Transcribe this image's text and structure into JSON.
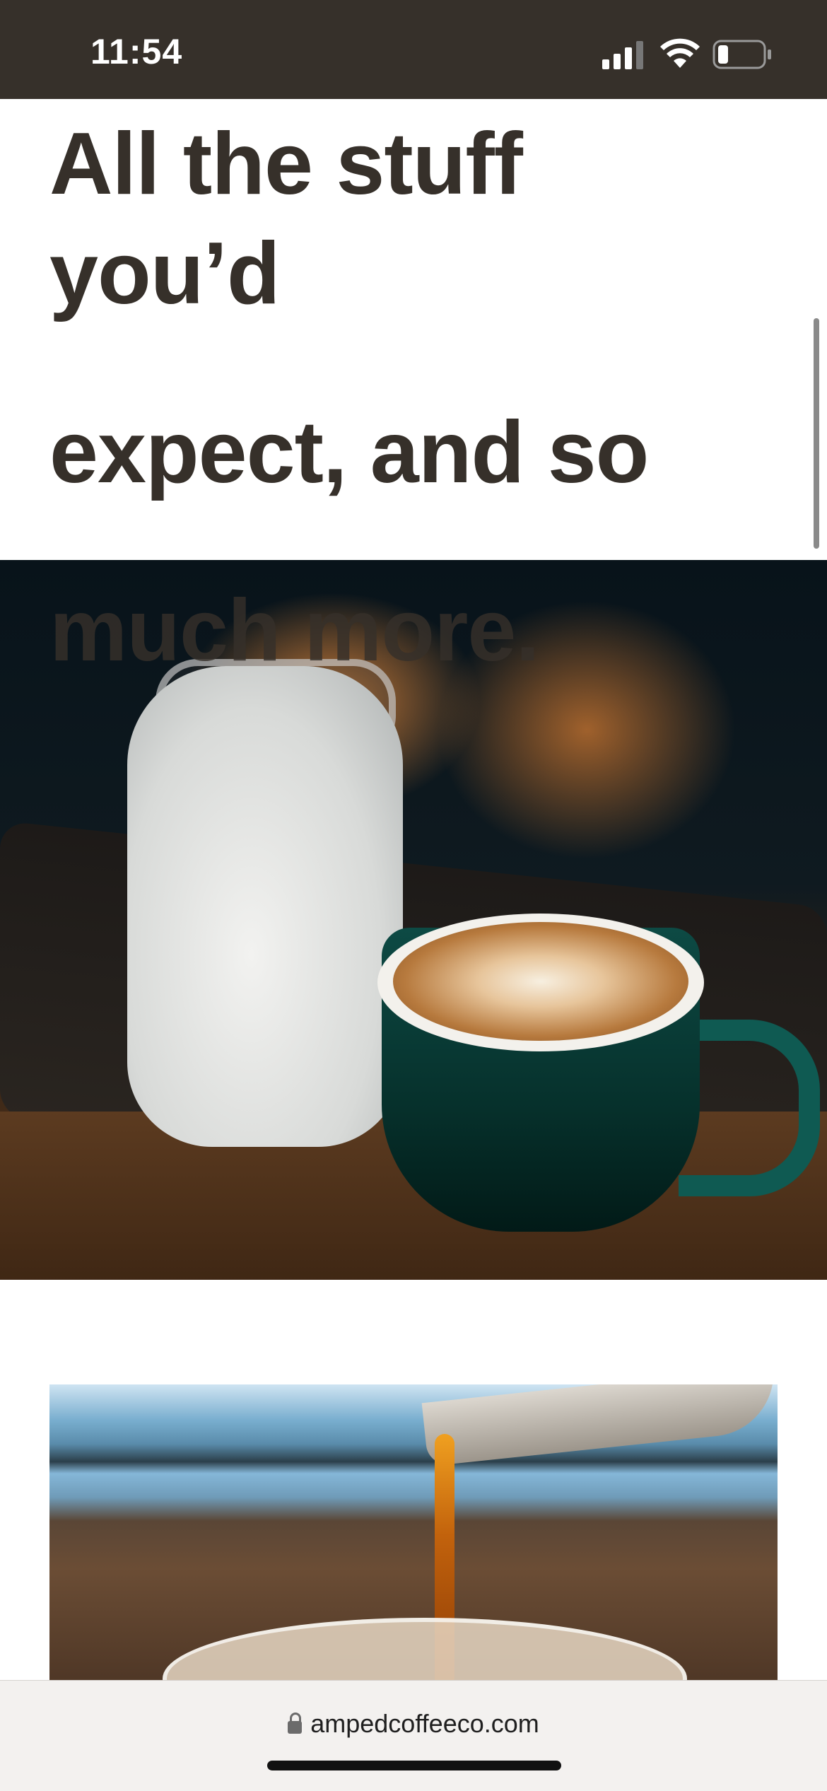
{
  "status_bar": {
    "time": "11:54",
    "icons": [
      "cellular-signal-icon",
      "wifi-icon",
      "battery-icon"
    ],
    "background": "#36302a"
  },
  "headline": {
    "lines": [
      "All the stuff",
      "you’d",
      "expect, and so",
      "much more."
    ],
    "color": "#36302a"
  },
  "images": {
    "hero": "latte art cup and milk jar on tray",
    "second": "espresso pouring over iced glass"
  },
  "browser": {
    "url": "ampedcoffeeco.com",
    "secure_icon": "lock-icon"
  }
}
